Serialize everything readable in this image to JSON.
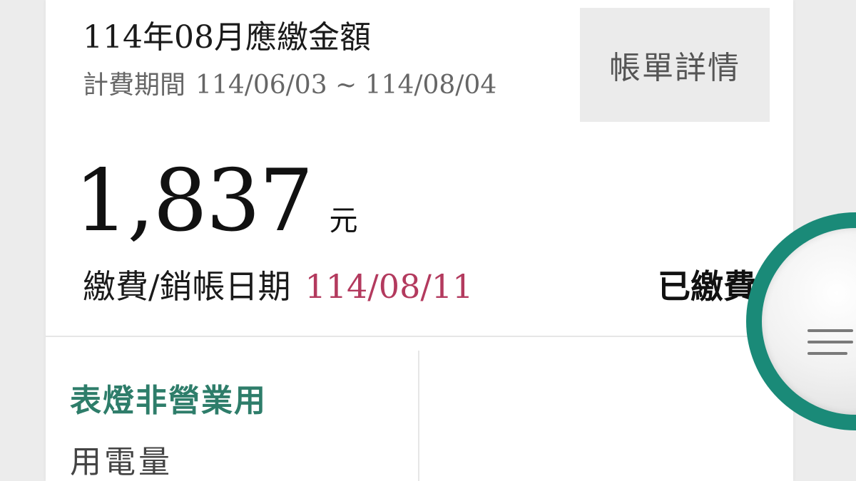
{
  "bill": {
    "title": "114年08月應繳金額",
    "period_label": "計費期間",
    "period_value": "114/06/03 ~ 114/08/04",
    "detail_button_label": "帳單詳情",
    "amount": "1,837",
    "currency_unit": "元",
    "pay_label": "繳費/銷帳日期",
    "pay_date": "114/08/11",
    "status": "已繳費"
  },
  "usage": {
    "category": "表燈非營業用",
    "label": "用電量"
  },
  "fab": {
    "icon": "menu-icon"
  },
  "colors": {
    "accent_green": "#2e7d6a",
    "fab_ring": "#1a8a78",
    "date_red": "#b33a5e"
  }
}
